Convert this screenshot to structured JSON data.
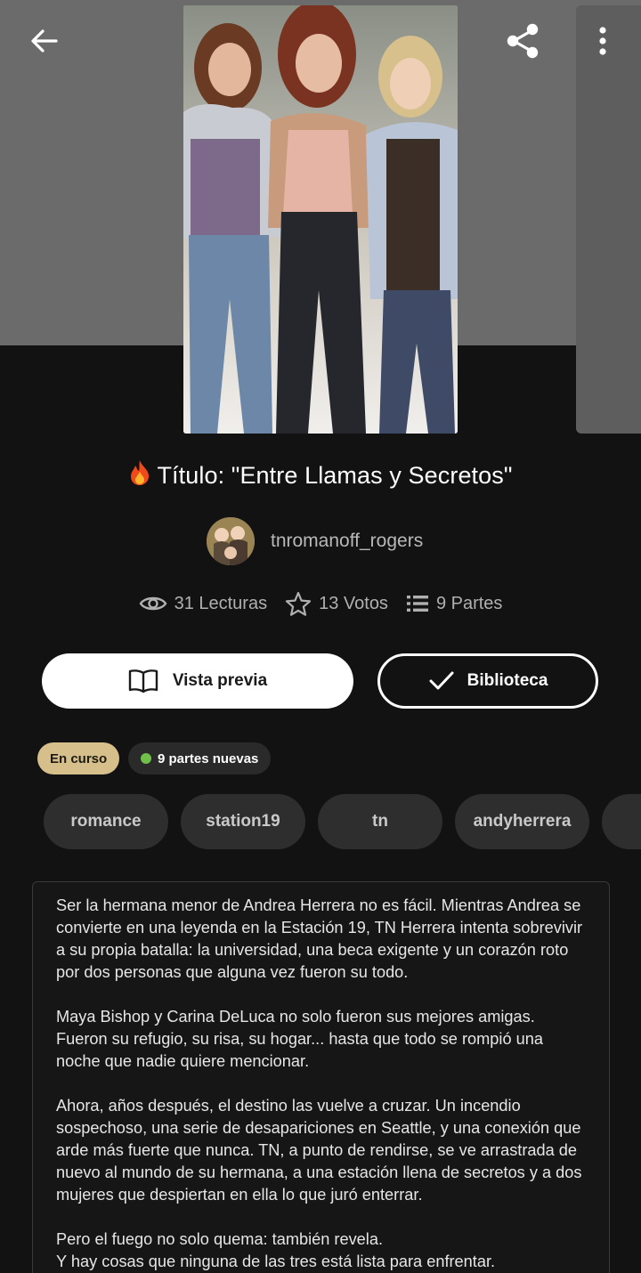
{
  "header": {
    "back_icon": "arrow-left-icon",
    "share_icon": "share-icon",
    "more_icon": "more-vertical-icon"
  },
  "story": {
    "title_emoji": "🔥",
    "title": "Título: \"Entre Llamas y Secretos\"",
    "author": "tnromanoff_rogers",
    "stats": {
      "reads": "31 Lecturas",
      "votes": "13 Votos",
      "parts": "9 Partes"
    }
  },
  "actions": {
    "preview_label": "Vista previa",
    "library_label": "Biblioteca"
  },
  "badges": {
    "status": "En curso",
    "new_parts": "9 partes nuevas"
  },
  "tags": [
    "romance",
    "station19",
    "tn",
    "andyherrera"
  ],
  "description": {
    "paragraphs": [
      "Ser la hermana menor de Andrea Herrera no es fácil. Mientras Andrea se convierte en una leyenda en la Estación 19, TN Herrera intenta sobrevivir a su propia batalla: la universidad, una beca exigente y un corazón roto por dos personas que alguna vez fueron su todo.",
      "Maya Bishop y Carina DeLuca no solo fueron sus mejores amigas. Fueron su refugio, su risa, su hogar... hasta que todo se rompió una noche que nadie quiere mencionar.",
      "Ahora, años después, el destino las vuelve a cruzar. Un incendio sospechoso, una serie de desapariciones en Seattle, y una conexión que arde más fuerte que nunca. TN, a punto de rendirse, se ve arrastrada de nuevo al mundo de su hermana, a una estación llena de secretos y a dos mujeres que despiertan en ella lo que juró enterrar.",
      "Pero el fuego no solo quema: también revela.\nY hay cosas que ninguna de las tres está lista para enfrentar."
    ]
  },
  "colors": {
    "background": "#121212",
    "status_badge": "#d6bf8a",
    "new_dot": "#6fbf4a"
  }
}
